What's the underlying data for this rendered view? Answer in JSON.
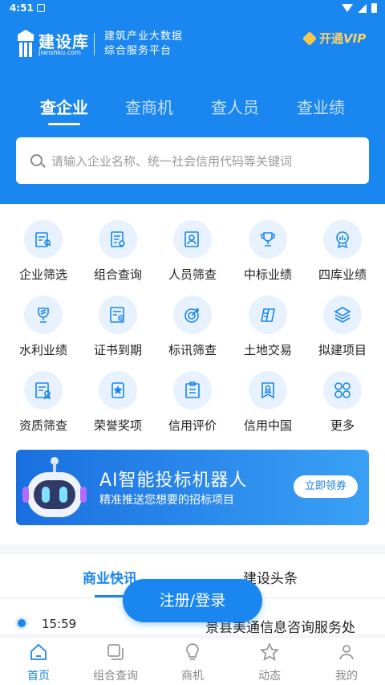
{
  "status": {
    "time": "4:51"
  },
  "header": {
    "logo_name": "建设库",
    "logo_domain": "Jianshku.com",
    "slogan_line1": "建筑产业大数据",
    "slogan_line2": "综合服务平台",
    "vip_label": "开通",
    "vip_suffix": "VIP"
  },
  "tabs": [
    {
      "label": "查企业",
      "active": true
    },
    {
      "label": "查商机",
      "active": false
    },
    {
      "label": "查人员",
      "active": false
    },
    {
      "label": "查业绩",
      "active": false
    }
  ],
  "search": {
    "placeholder": "请输入企业名称、统一社会信用代码等关键词"
  },
  "grid": [
    {
      "label": "企业筛选",
      "icon": "company-filter-icon"
    },
    {
      "label": "组合查询",
      "icon": "combo-query-icon"
    },
    {
      "label": "人员筛查",
      "icon": "person-search-icon"
    },
    {
      "label": "中标业绩",
      "icon": "trophy-icon"
    },
    {
      "label": "四库业绩",
      "icon": "chart-badge-icon"
    },
    {
      "label": "水利业绩",
      "icon": "water-trophy-icon"
    },
    {
      "label": "证书到期",
      "icon": "certificate-icon"
    },
    {
      "label": "标讯筛查",
      "icon": "target-icon"
    },
    {
      "label": "土地交易",
      "icon": "land-icon"
    },
    {
      "label": "拟建项目",
      "icon": "layers-icon"
    },
    {
      "label": "资质筛查",
      "icon": "qualification-icon"
    },
    {
      "label": "荣誉奖项",
      "icon": "honor-card-icon"
    },
    {
      "label": "信用评价",
      "icon": "clipboard-icon"
    },
    {
      "label": "信用中国",
      "icon": "credit-badge-icon"
    },
    {
      "label": "更多",
      "icon": "more-grid-icon"
    }
  ],
  "ai_banner": {
    "title": "AI智能投标机器人",
    "subtitle": "精准推送您想要的招标项目",
    "button": "立即领券"
  },
  "news": {
    "tabs": [
      {
        "label": "商业快讯",
        "active": true
      },
      {
        "label": "建设头条",
        "active": false
      }
    ],
    "item": {
      "time": "15:59",
      "title": "景县美通信息咨询服务处"
    }
  },
  "login_button": "注册/登录",
  "bottom_nav": [
    {
      "label": "首页",
      "icon": "home-icon",
      "active": true
    },
    {
      "label": "组合查询",
      "icon": "combo-icon",
      "active": false
    },
    {
      "label": "商机",
      "icon": "bulb-icon",
      "active": false
    },
    {
      "label": "动态",
      "icon": "star-icon",
      "active": false
    },
    {
      "label": "我的",
      "icon": "user-icon",
      "active": false
    }
  ],
  "colors": {
    "primary": "#1a86f0",
    "vip": "#ffd36a"
  }
}
